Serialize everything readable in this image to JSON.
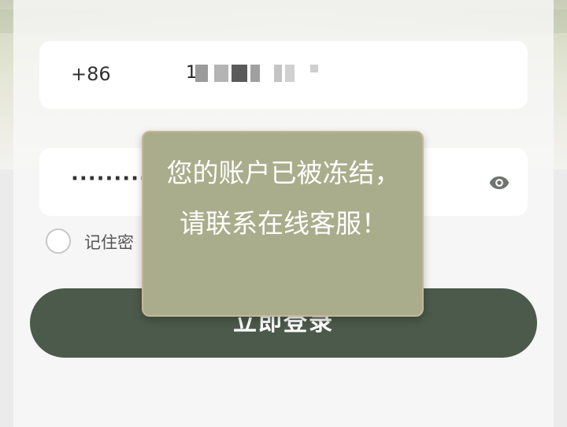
{
  "login_form": {
    "phone": {
      "country_code": "+86",
      "value_masked": "1",
      "mask_blocks": 7
    },
    "password": {
      "value_masked": "·········",
      "visibility_icon": "eye-icon"
    },
    "remember": {
      "label": "记住密码",
      "visible_label": "记住密",
      "checked": false
    },
    "submit_label": "立即登录"
  },
  "toast": {
    "message": "您的账户已被冻结，请联系在线客服！"
  },
  "colors": {
    "login_button": "#4b5a4a",
    "toast_background": "#a9ad8b",
    "field_background": "#ffffff"
  }
}
